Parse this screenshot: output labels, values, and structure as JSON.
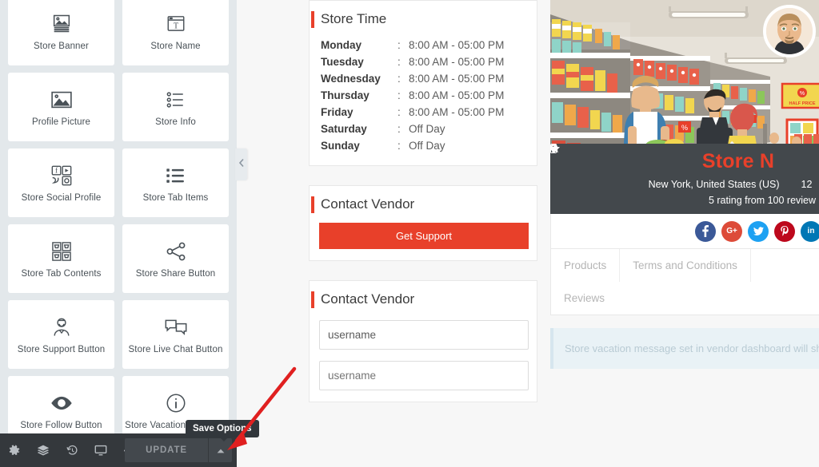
{
  "panel": {
    "widgets": [
      {
        "label": "Store Banner",
        "icon": "image-banner-icon"
      },
      {
        "label": "Store Name",
        "icon": "text-window-icon"
      },
      {
        "label": "Profile Picture",
        "icon": "image-icon"
      },
      {
        "label": "Store Info",
        "icon": "bullet-list-icon"
      },
      {
        "label": "Store Social Profile",
        "icon": "social-grid-icon"
      },
      {
        "label": "Store Tab Items",
        "icon": "list-icon"
      },
      {
        "label": "Store Tab Contents",
        "icon": "grid-cart-icon"
      },
      {
        "label": "Store Share Button",
        "icon": "share-icon"
      },
      {
        "label": "Store Support Button",
        "icon": "support-agent-icon"
      },
      {
        "label": "Store Live Chat Button",
        "icon": "chat-bubbles-icon"
      },
      {
        "label": "Store Follow Button",
        "icon": "eye-icon"
      },
      {
        "label": "Store Vacation Message",
        "icon": "info-circle-icon"
      }
    ],
    "collapse_icon": "chevron-left-icon"
  },
  "footer": {
    "icons": [
      {
        "name": "settings-gear-icon"
      },
      {
        "name": "navigator-layers-icon"
      },
      {
        "name": "history-revisions-icon"
      },
      {
        "name": "responsive-monitor-icon"
      },
      {
        "name": "preview-eye-icon"
      }
    ],
    "update_label": "UPDATE",
    "save_options_icon": "caret-up-icon",
    "tooltip": "Save Options"
  },
  "store_time": {
    "title": "Store Time",
    "separator": ":",
    "rows": [
      {
        "day": "Monday",
        "time": "8:00 AM - 05:00 PM"
      },
      {
        "day": "Tuesday",
        "time": "8:00 AM - 05:00 PM"
      },
      {
        "day": "Wednesday",
        "time": "8:00 AM - 05:00 PM"
      },
      {
        "day": "Thursday",
        "time": "8:00 AM - 05:00 PM"
      },
      {
        "day": "Friday",
        "time": "8:00 AM - 05:00 PM"
      },
      {
        "day": "Saturday",
        "time": "Off Day"
      },
      {
        "day": "Sunday",
        "time": "Off Day"
      }
    ]
  },
  "contact_support": {
    "title": "Contact Vendor",
    "button_label": "Get Support"
  },
  "contact_form": {
    "title": "Contact Vendor",
    "username_value": "username",
    "username_placeholder": "username"
  },
  "store_page": {
    "name": "Store N",
    "location": "New York, United States (US)",
    "location_icon": "map-pin-icon",
    "phone": "12",
    "phone_icon": "mobile-phone-icon",
    "rating": "5 rating from 100 review",
    "rating_icon": "star-icon",
    "social": [
      {
        "name": "facebook-icon",
        "glyph": "f",
        "color": "#3b5998"
      },
      {
        "name": "googleplus-icon",
        "glyph": "G+",
        "color": "#dd4b39"
      },
      {
        "name": "twitter-icon",
        "glyph": "t",
        "color": "#1da1f2"
      },
      {
        "name": "pinterest-icon",
        "glyph": "P",
        "color": "#bd081c"
      },
      {
        "name": "linkedin-icon",
        "glyph": "in",
        "color": "#0077b5"
      }
    ],
    "tabs": [
      {
        "label": "Products"
      },
      {
        "label": "Terms and Conditions"
      },
      {
        "label": "Reviews"
      }
    ],
    "vacation_notice": "Store vacation message set in vendor dashboard will sh"
  },
  "colors": {
    "accent_red": "#e8402a",
    "panel_bg": "#e3e8eb",
    "footer_bg": "#34383c",
    "info_bar": "#43484c",
    "annotation": "#e02020"
  }
}
